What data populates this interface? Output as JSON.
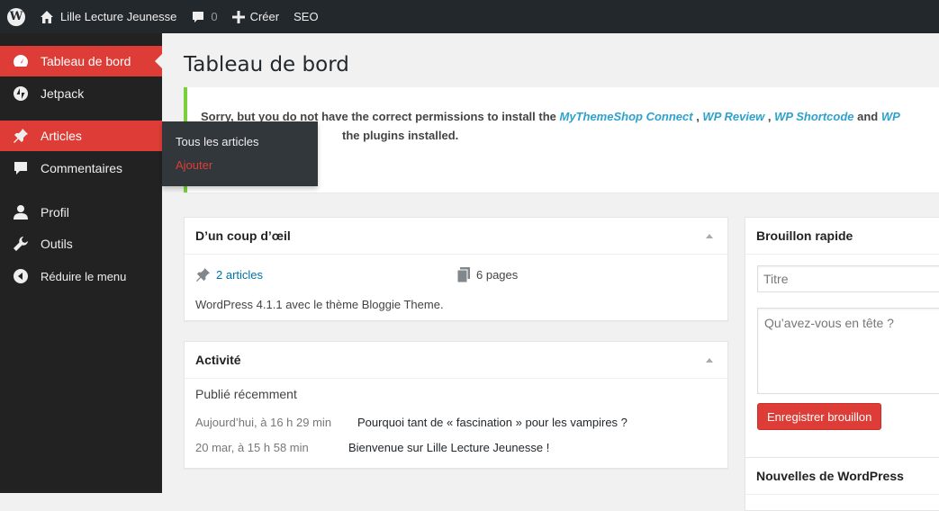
{
  "adminbar": {
    "site_name": "Lille Lecture Jeunesse",
    "comments_count": "0",
    "create_label": "Créer",
    "seo_label": "SEO"
  },
  "sidebar": {
    "items": [
      {
        "label": "Tableau de bord",
        "icon": "dashboard-icon"
      },
      {
        "label": "Jetpack",
        "icon": "jetpack-icon"
      },
      {
        "label": "Articles",
        "icon": "pin-icon"
      },
      {
        "label": "Commentaires",
        "icon": "comment-icon"
      },
      {
        "label": "Profil",
        "icon": "user-icon"
      },
      {
        "label": "Outils",
        "icon": "wrench-icon"
      },
      {
        "label": "Réduire le menu",
        "icon": "collapse-icon"
      }
    ],
    "flyout": {
      "all_articles": "Tous les articles",
      "add": "Ajouter"
    }
  },
  "main": {
    "title": "Tableau de bord",
    "notice": {
      "prefix": "Sorry, but you do not have the correct permissions to install the ",
      "plugin1": "MyThemeShop Connect",
      "sep1": " , ",
      "plugin2": "WP Review",
      "sep2": " , ",
      "plugin3": "WP Shortcode",
      "sep3": " and ",
      "plugin4": "WP",
      "line2": "the plugins installed."
    },
    "glance": {
      "title": "D’un coup d’œil",
      "articles": "2 articles",
      "pages": "6 pages",
      "version": "WordPress 4.1.1 avec le thème Bloggie Theme."
    },
    "activity": {
      "title": "Activité",
      "subheading": "Publié récemment",
      "rows": [
        {
          "date": "Aujourd’hui, à 16 h 29 min",
          "title": "Pourquoi tant de « fascination » pour les vampires ?"
        },
        {
          "date": "20 mar, à 15 h 58 min",
          "title": "Bienvenue sur Lille Lecture Jeunesse !"
        }
      ]
    },
    "quickdraft": {
      "title": "Brouillon rapide",
      "title_placeholder": "Titre",
      "content_placeholder": "Qu’avez-vous en tête ?",
      "save_label": "Enregistrer brouillon"
    },
    "news": {
      "title": "Nouvelles de WordPress"
    }
  },
  "colors": {
    "accent": "#dd3d36",
    "adminbar": "#23282d",
    "sidebar": "#222222",
    "notice_border": "#7ad03a",
    "link": "#0073aa"
  }
}
